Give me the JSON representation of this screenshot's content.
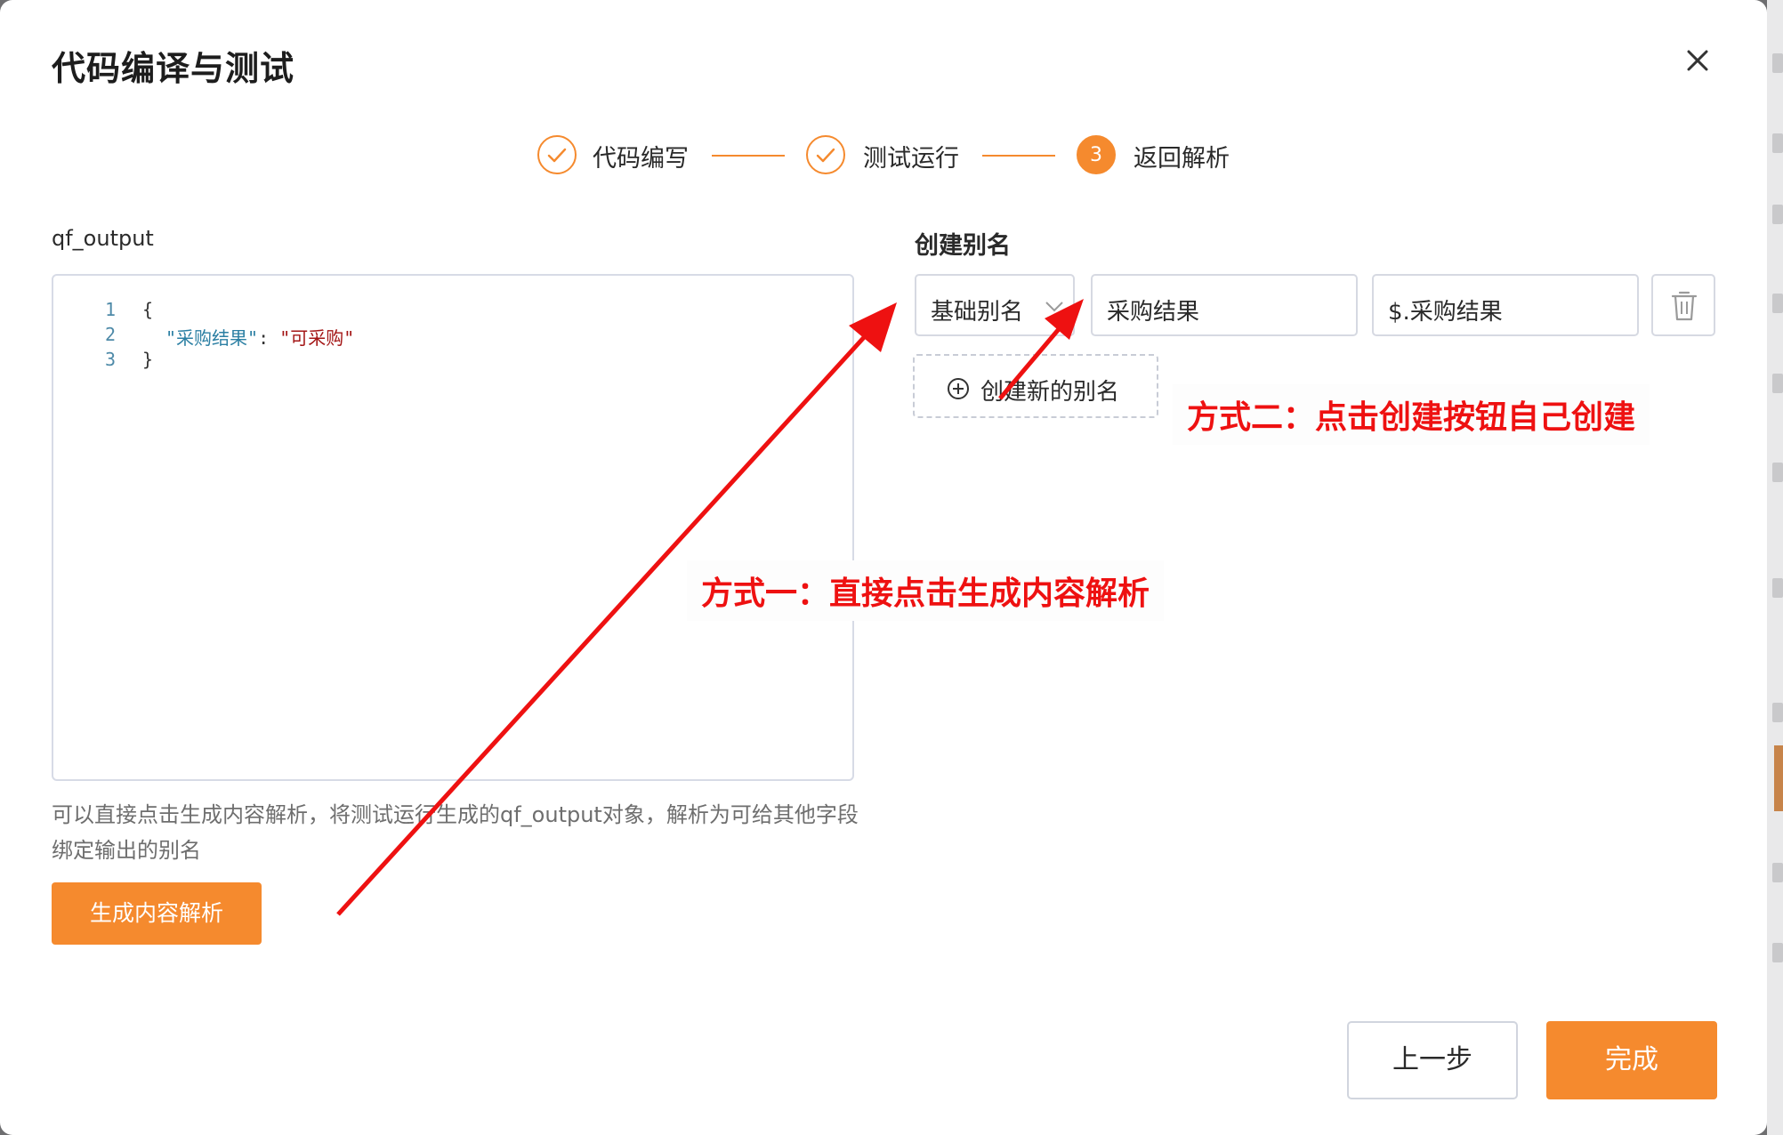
{
  "dialog": {
    "title": "代码编译与测试"
  },
  "steps": [
    {
      "label": "代码编写",
      "status": "done"
    },
    {
      "label": "测试运行",
      "status": "done"
    },
    {
      "label": "返回解析",
      "status": "active",
      "number": "3"
    }
  ],
  "left": {
    "field_label": "qf_output",
    "code_lines": [
      {
        "num": "1",
        "text": "{"
      },
      {
        "num": "2",
        "key": "\"采购结果\"",
        "sep": ": ",
        "value": "\"可采购\""
      },
      {
        "num": "3",
        "text": "}"
      }
    ],
    "hint": "可以直接点击生成内容解析，将测试运行生成的qf_output对象，解析为可给其他字段绑定输出的别名",
    "generate_button": "生成内容解析"
  },
  "right": {
    "section_title": "创建别名",
    "alias_row": {
      "type_select": "基础别名",
      "name_value": "采购结果",
      "path_value": "$.采购结果"
    },
    "create_button": "创建新的别名"
  },
  "annotations": {
    "method_one": "方式一：直接点击生成内容解析",
    "method_two": "方式二：点击创建按钮自己创建"
  },
  "footer": {
    "prev_button": "上一步",
    "done_button": "完成"
  },
  "colors": {
    "accent": "#f58a2e",
    "annotation": "#ee1111"
  }
}
